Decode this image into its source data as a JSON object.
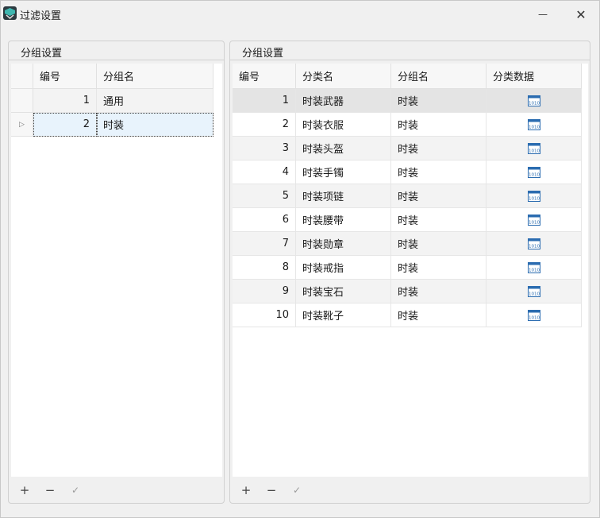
{
  "window": {
    "title": "过滤设置",
    "min_glyph": "—",
    "close_glyph": "✕"
  },
  "left_panel": {
    "title": "分组设置",
    "columns": [
      "编号",
      "分组名"
    ],
    "rows": [
      {
        "id": "1",
        "name": "通用"
      },
      {
        "id": "2",
        "name": "时装"
      }
    ],
    "toolbar": {
      "add": "+",
      "remove": "−",
      "confirm": "✓"
    }
  },
  "right_panel": {
    "title": "分组设置",
    "columns": [
      "编号",
      "分类名",
      "分组名",
      "分类数据"
    ],
    "rows": [
      {
        "id": "1",
        "category": "时装武器",
        "group": "时装"
      },
      {
        "id": "2",
        "category": "时装衣服",
        "group": "时装"
      },
      {
        "id": "3",
        "category": "时装头盔",
        "group": "时装"
      },
      {
        "id": "4",
        "category": "时装手镯",
        "group": "时装"
      },
      {
        "id": "5",
        "category": "时装项链",
        "group": "时装"
      },
      {
        "id": "6",
        "category": "时装腰带",
        "group": "时装"
      },
      {
        "id": "7",
        "category": "时装勋章",
        "group": "时装"
      },
      {
        "id": "8",
        "category": "时装戒指",
        "group": "时装"
      },
      {
        "id": "9",
        "category": "时装宝石",
        "group": "时装"
      },
      {
        "id": "10",
        "category": "时装靴子",
        "group": "时装"
      }
    ],
    "data_icon": "binary-data-icon",
    "toolbar": {
      "add": "+",
      "remove": "−",
      "confirm": "✓"
    }
  },
  "colors": {
    "selection": "#e8f3fc",
    "alt_row": "#f3f3f3",
    "header": "#f7f7f7",
    "icon_blue": "#2b6cb0"
  }
}
